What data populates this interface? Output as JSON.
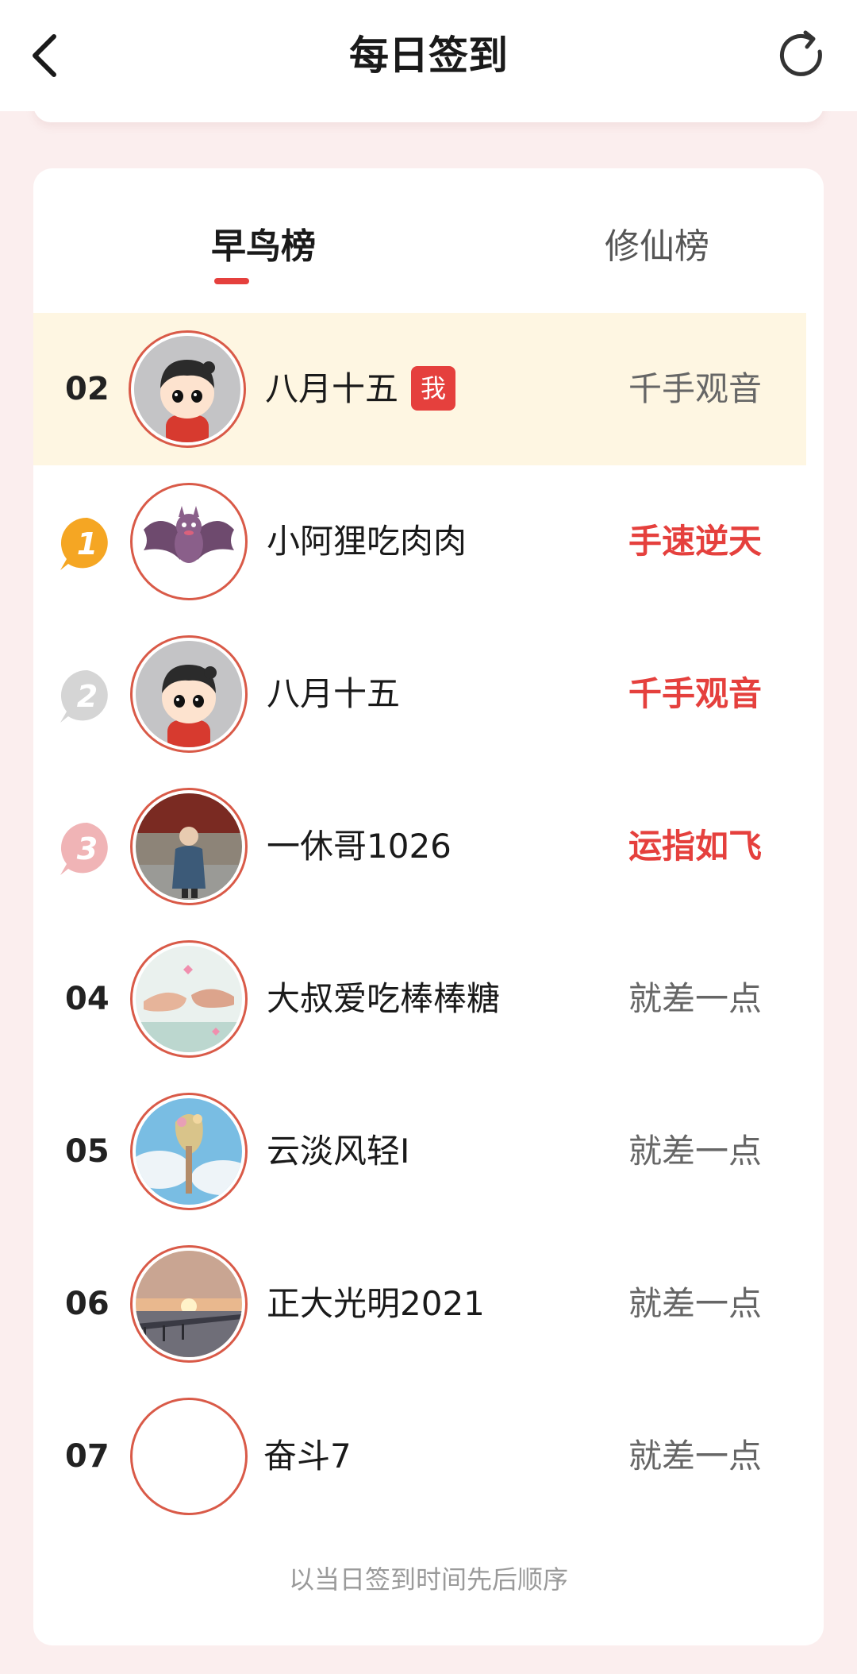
{
  "header": {
    "title": "每日签到"
  },
  "tabs": [
    {
      "label": "早鸟榜",
      "active": true
    },
    {
      "label": "修仙榜",
      "active": false
    }
  ],
  "me": {
    "rank": "02",
    "name": "八月十五",
    "badge": "我",
    "title": "千手观音"
  },
  "leaderboard": [
    {
      "rank": "1",
      "name": "小阿狸吃肉肉",
      "title": "手速逆天",
      "avatar_icon": "bat-avatar"
    },
    {
      "rank": "2",
      "name": "八月十五",
      "title": "千手观音",
      "avatar_icon": "cartoon-boy-avatar"
    },
    {
      "rank": "3",
      "name": "一休哥1026",
      "title": "运指如飞",
      "avatar_icon": "child-photo-avatar"
    },
    {
      "rank": "04",
      "name": "大叔爱吃棒棒糖",
      "title": "就差一点",
      "avatar_icon": "hands-photo-avatar"
    },
    {
      "rank": "05",
      "name": "云淡风轻I",
      "title": "就差一点",
      "avatar_icon": "flower-sky-avatar"
    },
    {
      "rank": "06",
      "name": "正大光明2021",
      "title": "就差一点",
      "avatar_icon": "sunset-avatar"
    },
    {
      "rank": "07",
      "name": "奋斗7",
      "title": "就差一点",
      "avatar_icon": "empty-avatar"
    }
  ],
  "footer_note": "以当日签到时间先后顺序",
  "colors": {
    "accent": "#e5403d",
    "gold": "#f5a623",
    "silver": "#d5d5d5",
    "bronze": "#f0b4b6",
    "highlight_row": "#fef6e2",
    "page_bg": "#fbeeee"
  }
}
